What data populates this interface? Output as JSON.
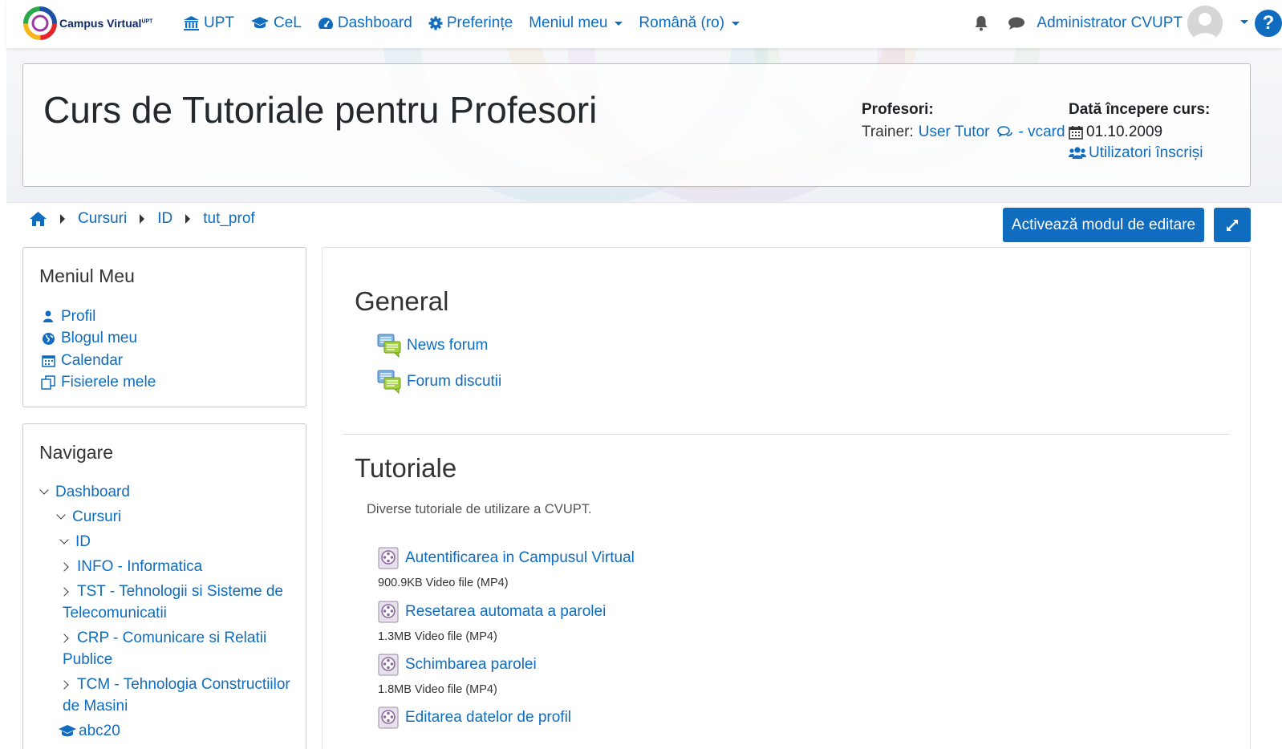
{
  "brand": {
    "name": "Campus Virtual",
    "superscript": "UPT"
  },
  "nav": {
    "items": [
      {
        "label": "UPT",
        "icon": "bank-icon"
      },
      {
        "label": "CeL",
        "icon": "graduation-cap-icon"
      },
      {
        "label": "Dashboard",
        "icon": "tachometer-icon"
      },
      {
        "label": "Preferințe",
        "icon": "gear-icon"
      },
      {
        "label": "Meniul meu",
        "icon": "",
        "dropdown": true
      },
      {
        "label": "Română (ro)",
        "icon": "",
        "dropdown": true
      }
    ],
    "user_name": "Administrator CVUPT",
    "help_label": "?"
  },
  "course": {
    "title": "Curs de Tutoriale pentru Profesori",
    "teachers_label": "Profesori:",
    "trainer_prefix": "Trainer:",
    "trainer_name": "User Tutor",
    "vcard_label": "- vcard",
    "start_label": "Dată începere curs:",
    "start_date": "01.10.2009",
    "enrolled_label": "Utilizatori înscriși"
  },
  "breadcrumb": [
    "Cursuri",
    "ID",
    "tut_prof"
  ],
  "edit_button": "Activează modul de editare",
  "my_menu": {
    "title": "Meniul Meu",
    "items": [
      {
        "label": "Profil",
        "icon": "user-icon"
      },
      {
        "label": "Blogul meu",
        "icon": "globe-icon"
      },
      {
        "label": "Calendar",
        "icon": "calendar-icon"
      },
      {
        "label": "Fisierele mele",
        "icon": "files-icon"
      }
    ]
  },
  "navigation": {
    "title": "Navigare",
    "items": [
      {
        "label": "Dashboard",
        "level": 0,
        "expanded": true
      },
      {
        "label": "Cursuri",
        "level": 1,
        "expanded": true
      },
      {
        "label": "ID",
        "level": 2,
        "expanded": true
      },
      {
        "label": "INFO - Informatica",
        "level": 3,
        "expanded": false
      },
      {
        "label": "TST - Tehnologii si Sisteme de",
        "label2": "Telecomunicatii",
        "level": 3,
        "expanded": false
      },
      {
        "label": "CRP - Comunicare si Relatii",
        "label2": "Publice",
        "level": 3,
        "expanded": false
      },
      {
        "label": "TCM - Tehnologia Constructiilor",
        "label2": "de Masini",
        "level": 3,
        "expanded": false
      },
      {
        "label": "abc20",
        "level": 2,
        "expanded": false,
        "icon": "graduation-cap-icon"
      }
    ]
  },
  "sections": {
    "general": {
      "title": "General",
      "activities": [
        {
          "name": "News forum",
          "icon": "forum-icon"
        },
        {
          "name": "Forum discutii",
          "icon": "forum-icon"
        }
      ]
    },
    "tutorials": {
      "title": "Tutoriale",
      "summary": "Diverse tutoriale de utilizare a CVUPT.",
      "activities": [
        {
          "name": "Autentificarea in Campusul Virtual",
          "meta": "900.9KB Video file (MP4)",
          "icon": "video-file-icon"
        },
        {
          "name": "Resetarea automata a parolei",
          "meta": "1.3MB Video file (MP4)",
          "icon": "video-file-icon"
        },
        {
          "name": "Schimbarea parolei",
          "meta": "1.8MB Video file (MP4)",
          "icon": "video-file-icon"
        },
        {
          "name": "Editarea datelor de profil",
          "meta": "",
          "icon": "video-file-icon"
        }
      ]
    }
  },
  "colors": {
    "primary": "#0f6cbf",
    "text": "#1d2125",
    "border": "#c8c8c8"
  }
}
